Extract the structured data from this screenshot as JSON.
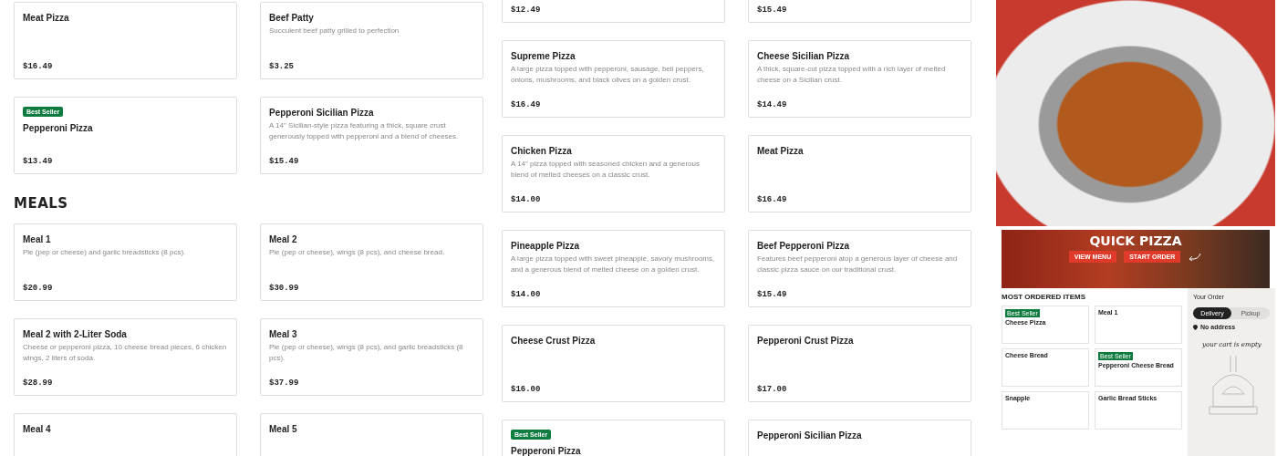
{
  "left_panel": {
    "top_items": [
      {
        "name": "Meat Pizza",
        "price": "$16.49"
      },
      {
        "name": "Beef Patty",
        "description": "Succulent beef patty grilled to perfection",
        "price": "$3.25"
      },
      {
        "badge": "Best Seller",
        "name": "Pepperoni Pizza",
        "price": "$13.49"
      },
      {
        "name": "Pepperoni Sicilian Pizza",
        "description": "A 14\" Sicilian-style pizza featuring a thick, square crust generously topped with pepperoni and a blend of cheeses.",
        "price": "$15.49"
      }
    ],
    "section_title": "MEALS",
    "meals": [
      {
        "name": "Meal 1",
        "description": "Pie (pep or cheese) and garlic breadsticks (8 pcs).",
        "price": "$20.99"
      },
      {
        "name": "Meal 2",
        "description": "Pie (pep or cheese), wings (8 pcs), and cheese bread.",
        "price": "$30.99"
      },
      {
        "name": "Meal 2 with 2-Liter Soda",
        "description": "Cheese or pepperoni pizza, 10 cheese bread pieces, 6 chicken wings, 2 liters of soda.",
        "price": "$28.99"
      },
      {
        "name": "Meal 3",
        "description": "Pie (pep or cheese), wings (8 pcs), and garlic breadsticks (8 pcs).",
        "price": "$37.99"
      },
      {
        "name": "Meal 4"
      },
      {
        "name": "Meal 5"
      }
    ]
  },
  "middle_panel": {
    "items": [
      {
        "price": "$12.49"
      },
      {
        "price": "$15.49"
      },
      {
        "name": "Supreme Pizza",
        "description": "A large pizza topped with pepperoni, sausage, bell peppers, onions, mushrooms, and black olives on a golden crust.",
        "price": "$16.49"
      },
      {
        "name": "Cheese Sicilian Pizza",
        "description": "A thick, square-cut pizza topped with a rich layer of melted cheese on a Sicilian crust.",
        "price": "$14.49"
      },
      {
        "name": "Chicken Pizza",
        "description": "A 14\" pizza topped with seasoned chicken and a generous blend of melted cheeses on a classic crust.",
        "price": "$14.00"
      },
      {
        "name": "Meat Pizza",
        "price": "$16.49"
      },
      {
        "name": "Pineapple Pizza",
        "description": "A large pizza topped with sweet pineapple, savory mushrooms, and a generous blend of melted cheese on a golden crust.",
        "price": "$14.00"
      },
      {
        "name": "Beef Pepperoni Pizza",
        "description": "Features beef pepperoni atop a generous layer of cheese and classic pizza sauce on our traditional crust.",
        "price": "$15.49"
      },
      {
        "name": "Cheese Crust Pizza",
        "price": "$16.00"
      },
      {
        "name": "Pepperoni Crust Pizza",
        "price": "$17.00"
      },
      {
        "badge": "Best Seller",
        "name": "Pepperoni Pizza"
      },
      {
        "name": "Pepperoni Sicilian Pizza"
      }
    ]
  },
  "website_preview": {
    "hero_title": "QUICK PIZZA",
    "buttons": [
      "VIEW MENU",
      "START ORDER"
    ],
    "section_title": "MOST ORDERED ITEMS",
    "items": [
      {
        "badge": "Best Seller",
        "name": "Cheese Pizza"
      },
      {
        "name": "Meal 1"
      },
      {
        "name": "Cheese Bread"
      },
      {
        "badge": "Best Seller",
        "name": "Pepperoni Cheese Bread"
      },
      {
        "name": "Snapple"
      },
      {
        "name": "Garlic Bread Sticks"
      }
    ],
    "order": {
      "title": "Your Order",
      "modes": [
        {
          "label": "Delivery",
          "selected": true
        },
        {
          "label": "Pickup",
          "selected": false
        }
      ],
      "address": "No address",
      "cart_note": "your cart is empty"
    }
  }
}
